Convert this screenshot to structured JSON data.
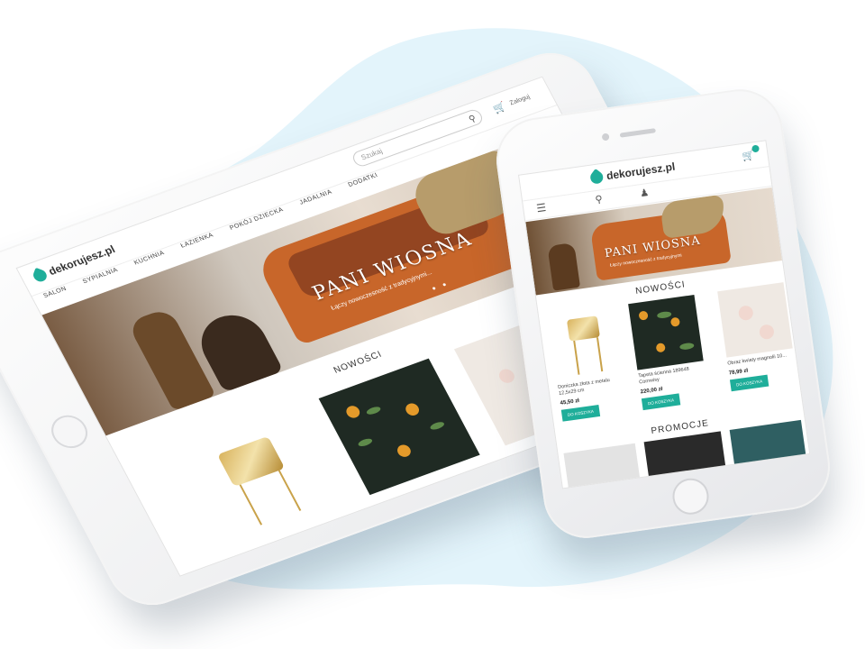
{
  "tablet": {
    "logo_text": "dekorujesz.pl",
    "search_placeholder": "Szukaj",
    "account_label": "Zaloguj",
    "nav_items": [
      "SALON",
      "SYPIALNIA",
      "KUCHNIA",
      "ŁAZIENKA",
      "POKÓJ DZIECKA",
      "JADALNIA",
      "DODATKI"
    ],
    "hero_title": "PANI WIOSNA",
    "hero_subtitle": "Łączy nowoczesność z tradycyjnymi...",
    "section_title": "NOWOŚCI"
  },
  "phone": {
    "logo_text": "dekorujesz.pl",
    "cart_count": "0",
    "hero_title": "PANI WIOSNA",
    "hero_subtitle": "Łączy nowoczesność z tradycyjnymi",
    "section_title": "NOWOŚCI",
    "products": [
      {
        "name": "Doniczka złota z metalu 12,5x29 cm",
        "price": "45,50 zł",
        "button": "DO KOSZYKA"
      },
      {
        "name": "Tapeta ścienna 189648 Cornwisy",
        "price": "220,00 zł",
        "button": "DO KOSZYKA"
      },
      {
        "name": "Obraz kwiaty magnolii 10...",
        "price": "78,99 zł",
        "button": "DO KOSZYKA"
      }
    ],
    "promo_title": "PROMOCJE"
  },
  "colors": {
    "accent": "#1fae9a",
    "background_blob": "#e3f4fb",
    "sofa": "#c8662a"
  }
}
